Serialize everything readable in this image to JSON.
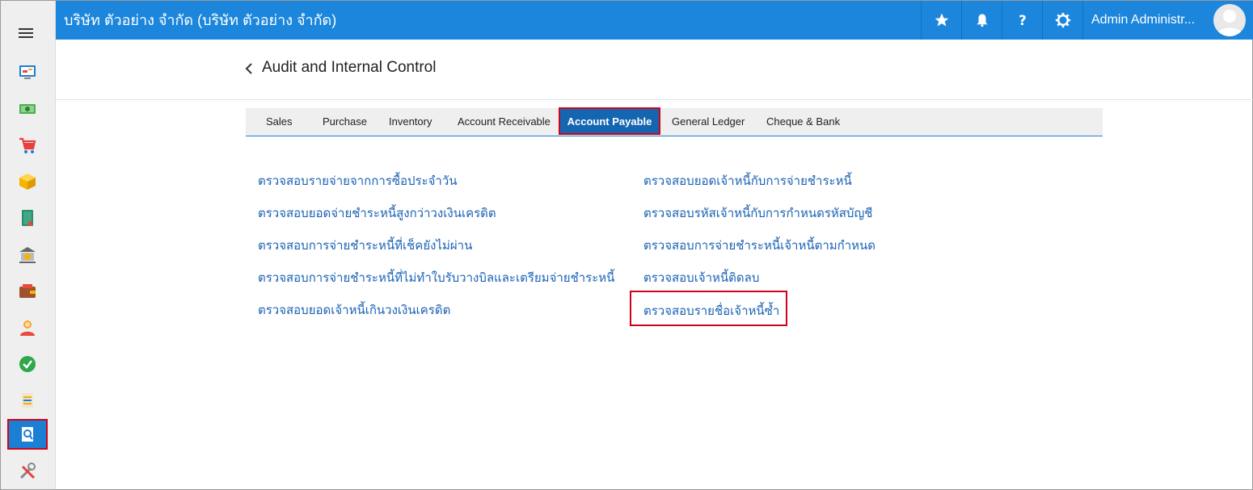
{
  "header": {
    "company": "บริษัท ตัวอย่าง จำกัด (บริษัท ตัวอย่าง จำกัด)",
    "user_name": "Admin Administr...",
    "icons": [
      "star-icon",
      "bell-icon",
      "question-icon",
      "gear-icon"
    ],
    "background": "#1b86dc"
  },
  "sidebar": {
    "items": [
      {
        "icon": "dashboard-icon"
      },
      {
        "icon": "money-icon"
      },
      {
        "icon": "cart-icon"
      },
      {
        "icon": "box-icon"
      },
      {
        "icon": "book-icon"
      },
      {
        "icon": "bank-icon"
      },
      {
        "icon": "wallet-icon"
      },
      {
        "icon": "people-icon"
      },
      {
        "icon": "check-icon"
      },
      {
        "icon": "transfer-icon"
      },
      {
        "icon": "audit-icon",
        "active": true
      },
      {
        "icon": "tools-icon"
      }
    ]
  },
  "page": {
    "title": "Audit and Internal Control"
  },
  "tabs": [
    {
      "label": "Sales"
    },
    {
      "label": "Purchase"
    },
    {
      "label": "Inventory"
    },
    {
      "label": "Account Receivable"
    },
    {
      "label": "Account Payable",
      "active": true
    },
    {
      "label": "General Ledger"
    },
    {
      "label": "Cheque & Bank"
    }
  ],
  "links": {
    "left": [
      "ตรวจสอบรายจ่ายจากการซื้อประจำวัน",
      "ตรวจสอบยอดจ่ายชำระหนี้สูงกว่าวงเงินเครดิต",
      "ตรวจสอบการจ่ายชำระหนี้ที่เช็คยังไม่ผ่าน",
      "ตรวจสอบการจ่ายชำระหนี้ที่ไม่ทำใบรับวางบิลและเตรียมจ่ายชำระหนี้",
      "ตรวจสอบยอดเจ้าหนี้เกินวงเงินเครดิต"
    ],
    "right": [
      "ตรวจสอบยอดเจ้าหนี้กับการจ่ายชำระหนี้",
      "ตรวจสอบรหัสเจ้าหนี้กับการกำหนดรหัสบัญชี",
      "ตรวจสอบการจ่ายชำระหนี้เจ้าหนี้ตามกำหนด",
      "ตรวจสอบเจ้าหนี้ติดลบ",
      "ตรวจสอบรายชื่อเจ้าหนี้ซ้ำ"
    ]
  },
  "colors": {
    "accent": "#1b86dc",
    "active_tab": "#1566b0",
    "link": "#1a62b5",
    "highlight": "#d0021b"
  }
}
